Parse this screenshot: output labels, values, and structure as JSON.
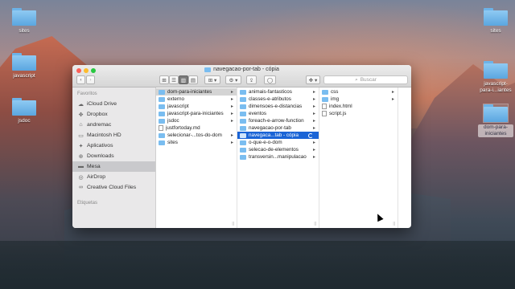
{
  "desktop": {
    "icons": [
      {
        "label": "sites"
      },
      {
        "label": "javascript"
      },
      {
        "label": "jsdoc"
      },
      {
        "label": "sites"
      },
      {
        "label": "javascript-para-i...iantes"
      },
      {
        "label": "dom-para-iniciantes"
      }
    ]
  },
  "window": {
    "title": "navegacao-por-tab - cópia",
    "toolbar": {
      "back": "‹",
      "forward": "›",
      "view_icons": "⊞",
      "view_list": "☰",
      "view_columns": "▥",
      "view_gallery": "▤",
      "arrange": "⊞ ▾",
      "action": "⚙ ▾",
      "share": "⇪",
      "tags": "◯",
      "dropbox": "✥ ▾",
      "search_placeholder": "Buscar"
    },
    "sidebar": {
      "favorites_header": "Favoritos",
      "tags_header": "Etiquetas",
      "items": [
        {
          "label": "iCloud Drive",
          "icon": "cloud-icon",
          "glyph": "☁"
        },
        {
          "label": "Dropbox",
          "icon": "dropbox-icon",
          "glyph": "✥"
        },
        {
          "label": "andremac",
          "icon": "home-icon",
          "glyph": "⌂"
        },
        {
          "label": "Macintosh HD",
          "icon": "disk-icon",
          "glyph": "▭"
        },
        {
          "label": "Aplicativos",
          "icon": "apps-icon",
          "glyph": "✦"
        },
        {
          "label": "Downloads",
          "icon": "downloads-icon",
          "glyph": "⊕"
        },
        {
          "label": "Mesa",
          "icon": "desktop-icon",
          "glyph": "▬"
        },
        {
          "label": "AirDrop",
          "icon": "airdrop-icon",
          "glyph": "◎"
        },
        {
          "label": "Creative Cloud Files",
          "icon": "creative-cloud-icon",
          "glyph": "∞"
        }
      ]
    },
    "columns": [
      [
        {
          "name": "dom-para-iniciantes",
          "type": "folder",
          "arrow": "▸"
        },
        {
          "name": "externo",
          "type": "folder",
          "arrow": "▸"
        },
        {
          "name": "javascript",
          "type": "folder",
          "arrow": "▸"
        },
        {
          "name": "javascript-para-iniciantes",
          "type": "folder",
          "arrow": "▸"
        },
        {
          "name": "jsdoc",
          "type": "folder",
          "arrow": "▸"
        },
        {
          "name": "justfortoday.md",
          "type": "file",
          "arrow": ""
        },
        {
          "name": "selecionar-...tos-do-dom",
          "type": "folder",
          "arrow": "▸"
        },
        {
          "name": "sites",
          "type": "folder",
          "arrow": "▸"
        }
      ],
      [
        {
          "name": "animais-fantasticos",
          "type": "folder",
          "arrow": "▸"
        },
        {
          "name": "classes-e-atributos",
          "type": "folder",
          "arrow": "▸"
        },
        {
          "name": "dimensoes-e-distancias",
          "type": "folder",
          "arrow": "▸"
        },
        {
          "name": "eventos",
          "type": "folder",
          "arrow": "▸"
        },
        {
          "name": "foreach-e-arrow-function",
          "type": "folder",
          "arrow": "▸"
        },
        {
          "name": "navegacao-por-tab",
          "type": "folder",
          "arrow": "▸"
        },
        {
          "name": "navegaca...tab - cópia",
          "type": "folder",
          "arrow": ""
        },
        {
          "name": "o-que-e-o-dom",
          "type": "folder",
          "arrow": "▸"
        },
        {
          "name": "selecao-de-elementos",
          "type": "folder",
          "arrow": "▸"
        },
        {
          "name": "transversin...manipulacao",
          "type": "folder",
          "arrow": "▸"
        }
      ],
      [
        {
          "name": "css",
          "type": "folder",
          "arrow": "▸"
        },
        {
          "name": "img",
          "type": "folder",
          "arrow": "▸"
        },
        {
          "name": "index.html",
          "type": "file",
          "arrow": ""
        },
        {
          "name": "script.js",
          "type": "file",
          "arrow": ""
        }
      ]
    ],
    "resize_handle": "||"
  }
}
